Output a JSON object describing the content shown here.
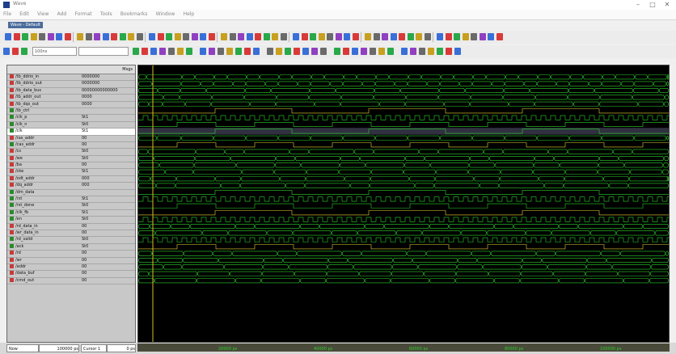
{
  "window": {
    "title": "Wave",
    "controls": [
      "–",
      "□",
      "✕"
    ]
  },
  "menu": {
    "items": [
      "File",
      "Edit",
      "View",
      "Add",
      "Format",
      "Tools",
      "Bookmarks",
      "Window",
      "Help"
    ]
  },
  "document_tab": {
    "label": "Wave - Default"
  },
  "toolbar": {
    "run_length": "100ns",
    "zoom_field": "",
    "icons": [
      "open-icon",
      "save-icon",
      "print-icon",
      "cut-icon",
      "copy-icon",
      "paste-icon",
      "undo-icon",
      "redo-icon",
      "find-icon",
      "zoom-in-icon",
      "zoom-out-icon",
      "zoom-full-icon",
      "run-icon",
      "step-icon",
      "break-icon",
      "restart-icon"
    ]
  },
  "colors": {
    "wave_green": "#2ad12a",
    "wave_yellow": "#e8d230",
    "cursor": "#d8c020",
    "bus_blue": "#3a6fd8",
    "bus_red": "#d83a3a"
  },
  "signal_panel": {
    "header_left": "",
    "header_right": "Msgs"
  },
  "signals": [
    {
      "name": "/tb_ddrio_in",
      "value": "0000000",
      "icon": "bus"
    },
    {
      "name": "/tb_ddrio_out",
      "value": "0000000",
      "icon": "bus"
    },
    {
      "name": "/tb_data_bus",
      "value": "00000000000000",
      "icon": "bus"
    },
    {
      "name": "/tb_addr_out",
      "value": "0000",
      "icon": "bus"
    },
    {
      "name": "/tb_dqs_out",
      "value": "0000",
      "icon": "bus"
    },
    {
      "name": "/tb_ctrl",
      "value": "",
      "icon": "bit"
    },
    {
      "name": "/clk_p",
      "value": "St1",
      "icon": "bit"
    },
    {
      "name": "/clk_n",
      "value": "St0",
      "icon": "bit"
    },
    {
      "name": "/clk",
      "value": "St1",
      "icon": "bit",
      "selected": true
    },
    {
      "name": "/ras_addr",
      "value": "00",
      "icon": "bus"
    },
    {
      "name": "/cas_addr",
      "value": "00",
      "icon": "bit"
    },
    {
      "name": "/cs",
      "value": "St0",
      "icon": "bus"
    },
    {
      "name": "/we",
      "value": "St0",
      "icon": "bus"
    },
    {
      "name": "/ba",
      "value": "00",
      "icon": "bus"
    },
    {
      "name": "/cke",
      "value": "St1",
      "icon": "bus"
    },
    {
      "name": "/odt_addr",
      "value": "000",
      "icon": "bus"
    },
    {
      "name": "/dq_addr",
      "value": "000",
      "icon": "bus"
    },
    {
      "name": "/dm_data",
      "value": "",
      "icon": "bit"
    },
    {
      "name": "/rst",
      "value": "St1",
      "icon": "bit"
    },
    {
      "name": "/rst_done",
      "value": "St0",
      "icon": "bit"
    },
    {
      "name": "/clk_fb",
      "value": "St1",
      "icon": "bit"
    },
    {
      "name": "/en",
      "value": "St0",
      "icon": "bit"
    },
    {
      "name": "/rd_data_in",
      "value": "00",
      "icon": "bus"
    },
    {
      "name": "/wr_data_in",
      "value": "00",
      "icon": "bus"
    },
    {
      "name": "/rd_valid",
      "value": "St0",
      "icon": "bit"
    },
    {
      "name": "/ack",
      "value": "St0",
      "icon": "bit"
    },
    {
      "name": "/rd",
      "value": "00",
      "icon": "bus"
    },
    {
      "name": "/wr",
      "value": "00",
      "icon": "bus"
    },
    {
      "name": "/addr",
      "value": "00",
      "icon": "bus"
    },
    {
      "name": "/data_buf",
      "value": "00",
      "icon": "bus"
    },
    {
      "name": "/cmd_out",
      "value": "00",
      "icon": "bus"
    }
  ],
  "status": {
    "now_label": "Now",
    "now_value": "100000 ps",
    "cursor_label": "Cursor 1",
    "cursor_value": "0 ps"
  },
  "timeline": {
    "labels": [
      "20000 ps",
      "40000 ps",
      "60000 ps",
      "80000 ps",
      "100000 ps"
    ]
  }
}
